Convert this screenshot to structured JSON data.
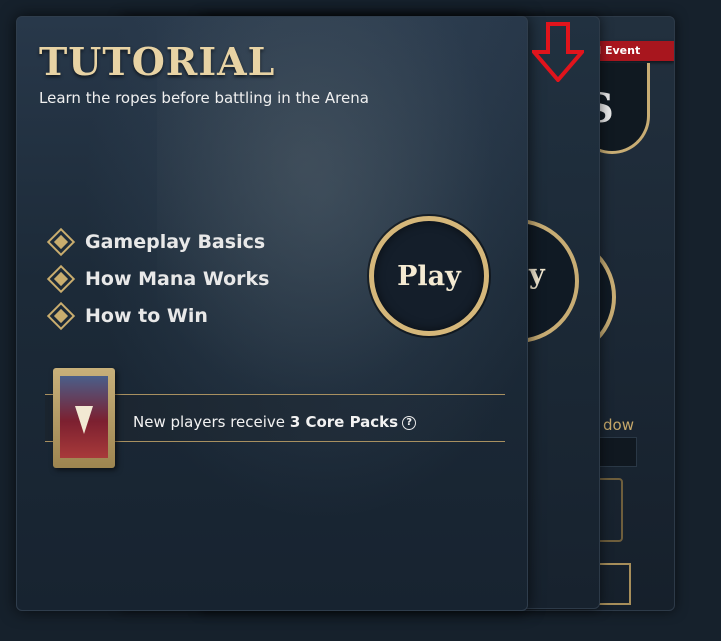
{
  "background_card": {
    "event_ribbon": "end Event",
    "emblem_letter": "S",
    "play_partial": "y",
    "window_text": "dow"
  },
  "middle_card": {
    "play_partial": "y"
  },
  "tutorial": {
    "title": "TUTORIAL",
    "subtitle": "Learn the ropes before battling in the Arena",
    "lessons": [
      {
        "label": "Gameplay Basics"
      },
      {
        "label": "How Mana Works"
      },
      {
        "label": "How to Win"
      }
    ],
    "play_label": "Play",
    "reward_prefix": "New players receive ",
    "reward_bold": "3 Core Packs",
    "help_symbol": "?"
  },
  "colors": {
    "gold": "#c8ad74",
    "ribbon_red": "#a8161e",
    "annotation_red": "#e0141c"
  },
  "icons": [
    "diamond-icon",
    "pack-icon",
    "help-icon",
    "arrow-down-icon"
  ]
}
